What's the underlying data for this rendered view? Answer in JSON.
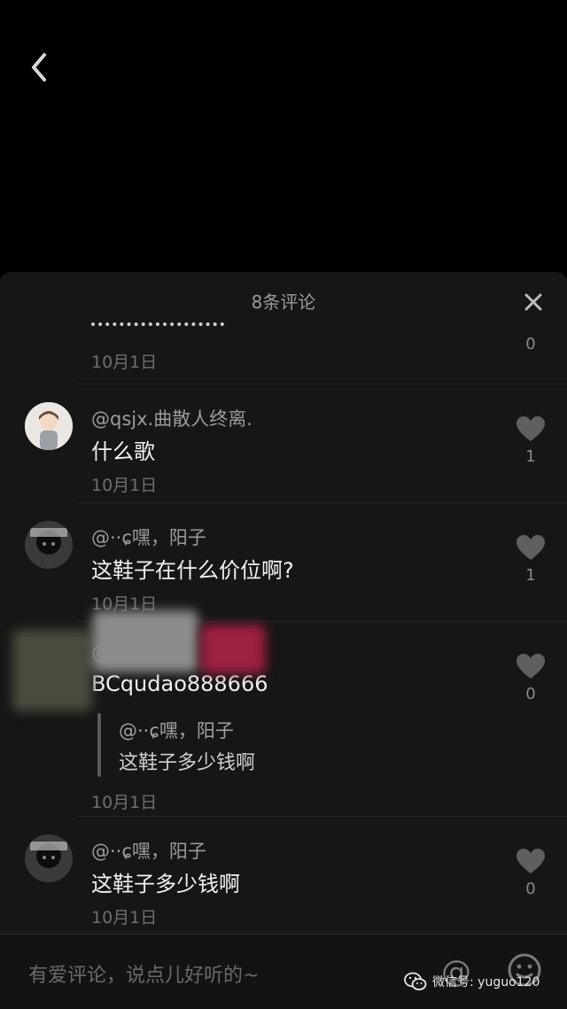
{
  "panel": {
    "title": "8条评论"
  },
  "comments": [
    {
      "user": "",
      "text": "",
      "date": "10月1日",
      "likes": "0"
    },
    {
      "user": "@qsjx.曲散人终离.",
      "text": "什么歌",
      "date": "10月1日",
      "likes": "1"
    },
    {
      "user": "@··ɕ嘿，阳子",
      "text": "这鞋子在什么价位啊?",
      "date": "10月1日",
      "likes": "1"
    },
    {
      "user": "@",
      "text": "BCqudao888666",
      "date": "10月1日",
      "likes": "0",
      "reply_to": {
        "user": "@··ɕ嘿，阳子",
        "text": "这鞋子多少钱啊"
      }
    },
    {
      "user": "@··ɕ嘿，阳子",
      "text": "这鞋子多少钱啊",
      "date": "10月1日",
      "likes": "0"
    }
  ],
  "input": {
    "placeholder": "有爱评论，说点儿好听的~",
    "at_label": "@"
  },
  "watermark": {
    "text": "微信号: yuguo120"
  },
  "icons": [
    "back-icon",
    "close-icon",
    "heart-icon",
    "emoji-icon",
    "wechat-icon"
  ]
}
